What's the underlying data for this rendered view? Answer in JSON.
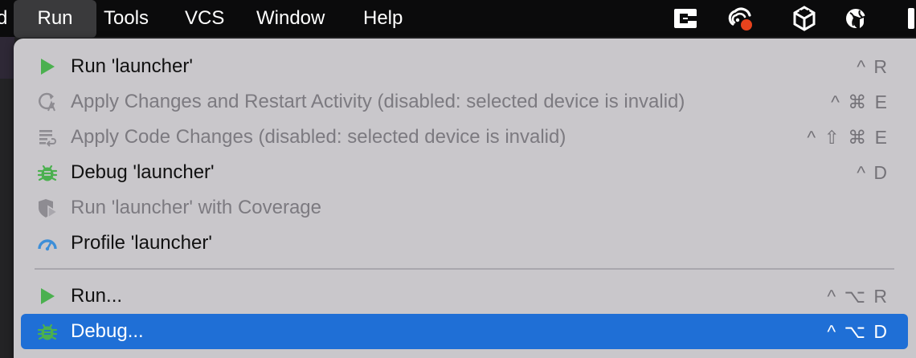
{
  "menubar": {
    "partial_item": "d",
    "items": [
      "Run",
      "Tools",
      "VCS",
      "Window",
      "Help"
    ],
    "active_item": "Run",
    "status_icons": [
      "cornerstone-icon",
      "creative-cloud-sync-icon",
      "unity-icon",
      "vpn-globe-shield-icon"
    ],
    "notification_dot_color": "#e8431d"
  },
  "menu": {
    "items": [
      {
        "label": "Run 'launcher'",
        "shortcut": "^ R",
        "icon": "run-play-icon",
        "enabled": true
      },
      {
        "label": "Apply Changes and Restart Activity (disabled: selected device is invalid)",
        "shortcut": "^ ⌘ E",
        "icon": "apply-changes-restart-icon",
        "enabled": false
      },
      {
        "label": "Apply Code Changes (disabled: selected device is invalid)",
        "shortcut": "^ ⇧ ⌘ E",
        "icon": "apply-code-changes-icon",
        "enabled": false
      },
      {
        "label": "Debug 'launcher'",
        "shortcut": "^ D",
        "icon": "debug-bug-icon",
        "enabled": true
      },
      {
        "label": "Run 'launcher' with Coverage",
        "shortcut": "",
        "icon": "coverage-shield-icon",
        "enabled": false
      },
      {
        "label": "Profile 'launcher'",
        "shortcut": "",
        "icon": "profiler-gauge-icon",
        "enabled": true
      },
      {
        "label": "Run...",
        "shortcut": "^ ⌥ R",
        "icon": "run-play-icon",
        "enabled": true
      },
      {
        "label": "Debug...",
        "shortcut": "^ ⌥ D",
        "icon": "debug-bug-icon",
        "enabled": true,
        "highlighted": true
      }
    ]
  },
  "colors": {
    "menu_background": "#c9c7cb",
    "highlight": "#1f6fd6",
    "run_green": "#4bb04f",
    "profiler_blue": "#3d8ed8"
  }
}
